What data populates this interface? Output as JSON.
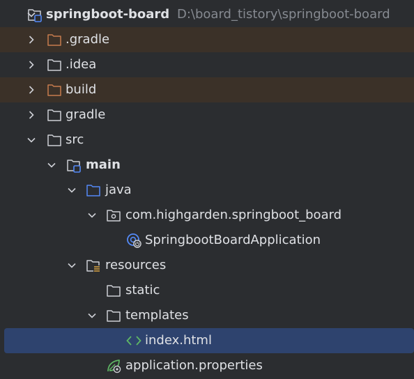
{
  "colors": {
    "background": "#2b2d30",
    "text": "#dfe1e5",
    "muted_text": "#868a91",
    "excluded_row": "#3b3128",
    "selected_row": "#2e436e",
    "folder_plain": "#ced0d6",
    "folder_excluded": "#c77c4e",
    "folder_source": "#548af7",
    "module_badge": "#548af7",
    "resources_badge": "#d9a343",
    "html_icon": "#5fb865",
    "spring_leaf": "#5fb865"
  },
  "project": {
    "name": "springboot-board",
    "path": "D:\\board_tistory\\springboot-board"
  },
  "nodes": {
    "gradle_hidden": {
      "label": ".gradle",
      "icon": "folder-excluded-icon"
    },
    "idea": {
      "label": ".idea",
      "icon": "folder-icon"
    },
    "build": {
      "label": "build",
      "icon": "folder-excluded-icon"
    },
    "gradle": {
      "label": "gradle",
      "icon": "folder-icon"
    },
    "src": {
      "label": "src",
      "icon": "folder-icon"
    },
    "main": {
      "label": "main",
      "icon": "module-folder-icon"
    },
    "java": {
      "label": "java",
      "icon": "source-folder-icon"
    },
    "package": {
      "label": "com.highgarden.springboot_board",
      "icon": "package-icon"
    },
    "app_class": {
      "label": "SpringbootBoardApplication",
      "icon": "spring-boot-class-icon"
    },
    "resources": {
      "label": "resources",
      "icon": "resources-folder-icon"
    },
    "static": {
      "label": "static",
      "icon": "folder-icon"
    },
    "templates": {
      "label": "templates",
      "icon": "folder-icon"
    },
    "index_html": {
      "label": "index.html",
      "icon": "html-file-icon"
    },
    "app_properties": {
      "label": "application.properties",
      "icon": "spring-properties-icon"
    }
  }
}
